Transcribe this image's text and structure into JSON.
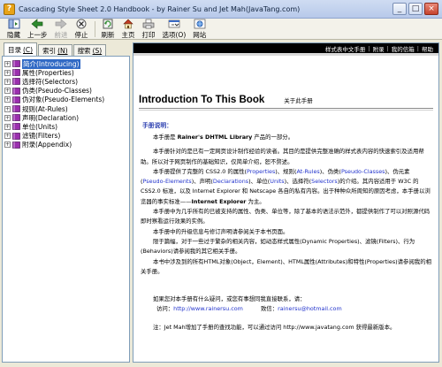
{
  "window": {
    "title": "Cascading Style Sheet 2.0 Handbook - by Rainer Su and Jet Mah(JavaTang.com)",
    "controls": [
      "_",
      "□",
      "×"
    ]
  },
  "toolbar": [
    {
      "label": "隐藏",
      "icon": "hide-icon",
      "disabled": false
    },
    {
      "label": "上一步",
      "icon": "back-arrow-icon",
      "disabled": false
    },
    {
      "label": "前进",
      "icon": "forward-arrow-icon",
      "disabled": true
    },
    {
      "label": "停止",
      "icon": "stop-icon",
      "disabled": false
    },
    {
      "label": "刷新",
      "icon": "refresh-icon",
      "disabled": false
    },
    {
      "label": "主页",
      "icon": "home-icon",
      "disabled": false
    },
    {
      "label": "打印",
      "icon": "print-icon",
      "disabled": false
    },
    {
      "label": "选项(O)",
      "icon": "options-icon",
      "disabled": false
    },
    {
      "label": "网站",
      "icon": "web-icon",
      "disabled": false
    }
  ],
  "tabs": [
    {
      "label": "目录",
      "key": "(C)",
      "active": true
    },
    {
      "label": "索引",
      "key": "(N)",
      "active": false
    },
    {
      "label": "搜索",
      "key": "(S)",
      "active": false
    }
  ],
  "tree": [
    {
      "label": "简介(Introducing)",
      "selected": true
    },
    {
      "label": "属性(Properties)",
      "selected": false
    },
    {
      "label": "选择符(Selectors)",
      "selected": false
    },
    {
      "label": "伪类(Pseudo-Classes)",
      "selected": false
    },
    {
      "label": "伪对象(Pseudo-Elements)",
      "selected": false
    },
    {
      "label": "规则(At-Rules)",
      "selected": false
    },
    {
      "label": "声明(Declaration)",
      "selected": false
    },
    {
      "label": "单位(Units)",
      "selected": false
    },
    {
      "label": "滤镜(Filters)",
      "selected": false
    },
    {
      "label": "附录(Appendix)",
      "selected": false
    }
  ],
  "topnav": [
    "样式表中文手册",
    "附录",
    "我的信箱",
    "帮助"
  ],
  "content": {
    "title": "Introduction To This Book",
    "about": "关于此手册",
    "section": "手册说明：",
    "p1": {
      "a": "本手册是 ",
      "b": "Rainer's DHTML Library",
      "c": " 产品的一部分。"
    },
    "p2": "本手册针对的是已有一定网页设计制作经验的读者。其目的是提供完整准确的样式表内容的快速索引及适用帮助。所以对于网页制作的基础知识，仅简单介绍，恕不赘述。",
    "p3": {
      "a": "本手册提供了完整的 CSS2.0 的属性(",
      "l1": "Properties",
      "b": ")、规则(",
      "l2": "At-Rules",
      "c": ")、伪类(",
      "l3": "Pseudo-Classes",
      "d": ")、伪元素(",
      "l4": "Pseudo-Elements",
      "e": ")、声明(",
      "l5": "Declarations",
      "f": ")、单位(",
      "l6": "Units",
      "g": ")、选择符(",
      "l7": "Selectors",
      "h": ")的介绍。其内容适用于 W3C 的 CSS2.0 标准，以及 Internet Explorer 和 Netscape 各自的私有内容。出于种种众所周知的原因考虑，本手册以浏览器的事实标准——",
      "bold": "Internet Explorer",
      "i": " 为主。"
    },
    "p4": "本手册中为几乎所有的已被支持的属性、伪类、单位等，除了基本的语法示范外，都提供制作了可以对照源代码即时察看运行效果的实例。",
    "p5": "本手册中的升级信息与修订声明请参阅关于本书页面。",
    "p6": "限于篇幅，对于一些过于繁杂的相关内容，如动态样式属性(Dynamic Properties)、滤镜(Filters)、行为(Behaviors)请参阅我的其它相关手册。",
    "p7": "本书中涉及到的所有HTML对象(Object，Element)、HTML属性(Attributes)和特性(Properties)请参阅我的相关手册。",
    "contact_intro": "如果您对本手册有什么疑问，或您有事想同我直接联系，请：",
    "visit_label": "访问：",
    "site": "http://www.rainersu.com",
    "mail_label": "致信：",
    "email": "rainersu@hotmail.com",
    "note": "注：Jet Mah增加了手册的查找功能，可以通过访问 http://www.javatang.com 获得最新版本。"
  }
}
